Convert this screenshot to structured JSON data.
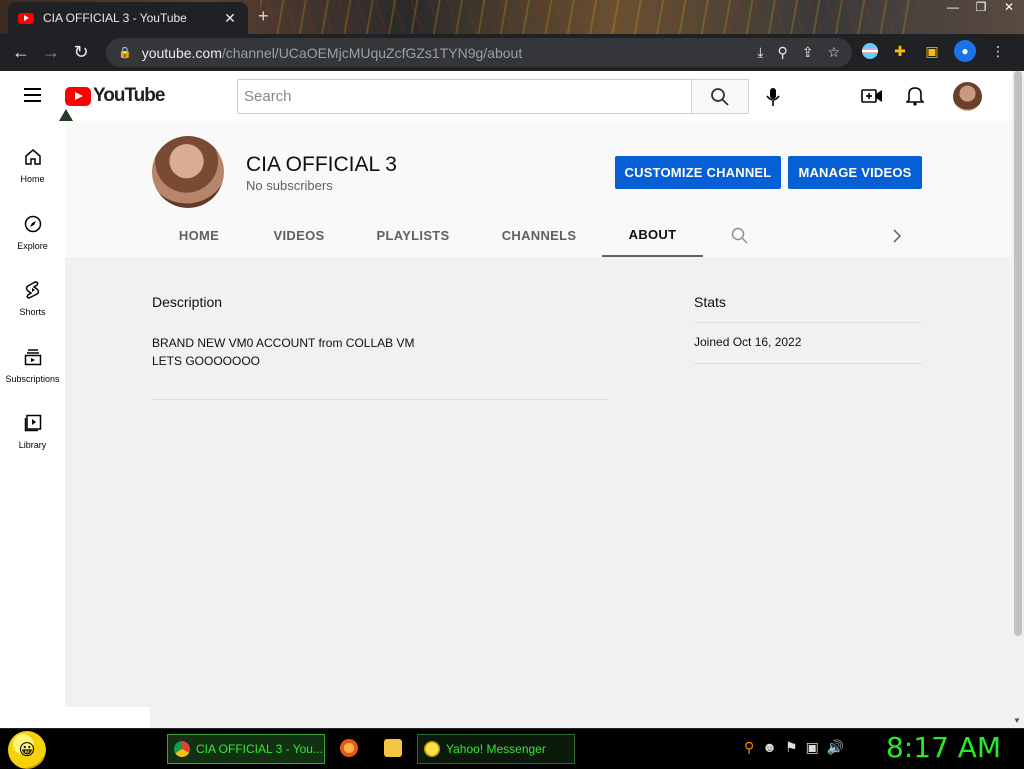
{
  "browser": {
    "tab_title": "CIA OFFICIAL 3 - YouTube",
    "tab_close": "✕",
    "new_tab": "+",
    "url_host": "youtube.com",
    "url_path": "/channel/UCaOEMjcMUquZcfGZs1TYN9g/about"
  },
  "youtube": {
    "logo_text": "YouTube",
    "search_placeholder": "Search"
  },
  "sidebar": {
    "items": [
      {
        "label": "Home",
        "icon": "home-icon"
      },
      {
        "label": "Explore",
        "icon": "compass-icon"
      },
      {
        "label": "Shorts",
        "icon": "shorts-icon"
      },
      {
        "label": "Subscriptions",
        "icon": "subscriptions-icon"
      },
      {
        "label": "Library",
        "icon": "library-icon"
      }
    ]
  },
  "channel": {
    "name": "CIA OFFICIAL 3",
    "subscribers": "No subscribers",
    "customize_label": "CUSTOMIZE CHANNEL",
    "manage_label": "MANAGE VIDEOS",
    "tabs": [
      "HOME",
      "VIDEOS",
      "PLAYLISTS",
      "CHANNELS",
      "ABOUT"
    ],
    "active_tab": "ABOUT"
  },
  "about": {
    "description_heading": "Description",
    "description_line1": "BRAND NEW VM0 ACCOUNT from COLLAB VM",
    "description_line2": "LETS GOOOOOOO",
    "stats_heading": "Stats",
    "joined": "Joined Oct 16, 2022"
  },
  "taskbar": {
    "chrome_task": "CIA OFFICIAL 3 - You...",
    "yahoo_task": "Yahoo! Messenger",
    "clock": "8:17 AM"
  },
  "colors": {
    "brand_red": "#ff0000",
    "button_blue": "#065fd4",
    "taskbar_green": "#22ee22"
  }
}
